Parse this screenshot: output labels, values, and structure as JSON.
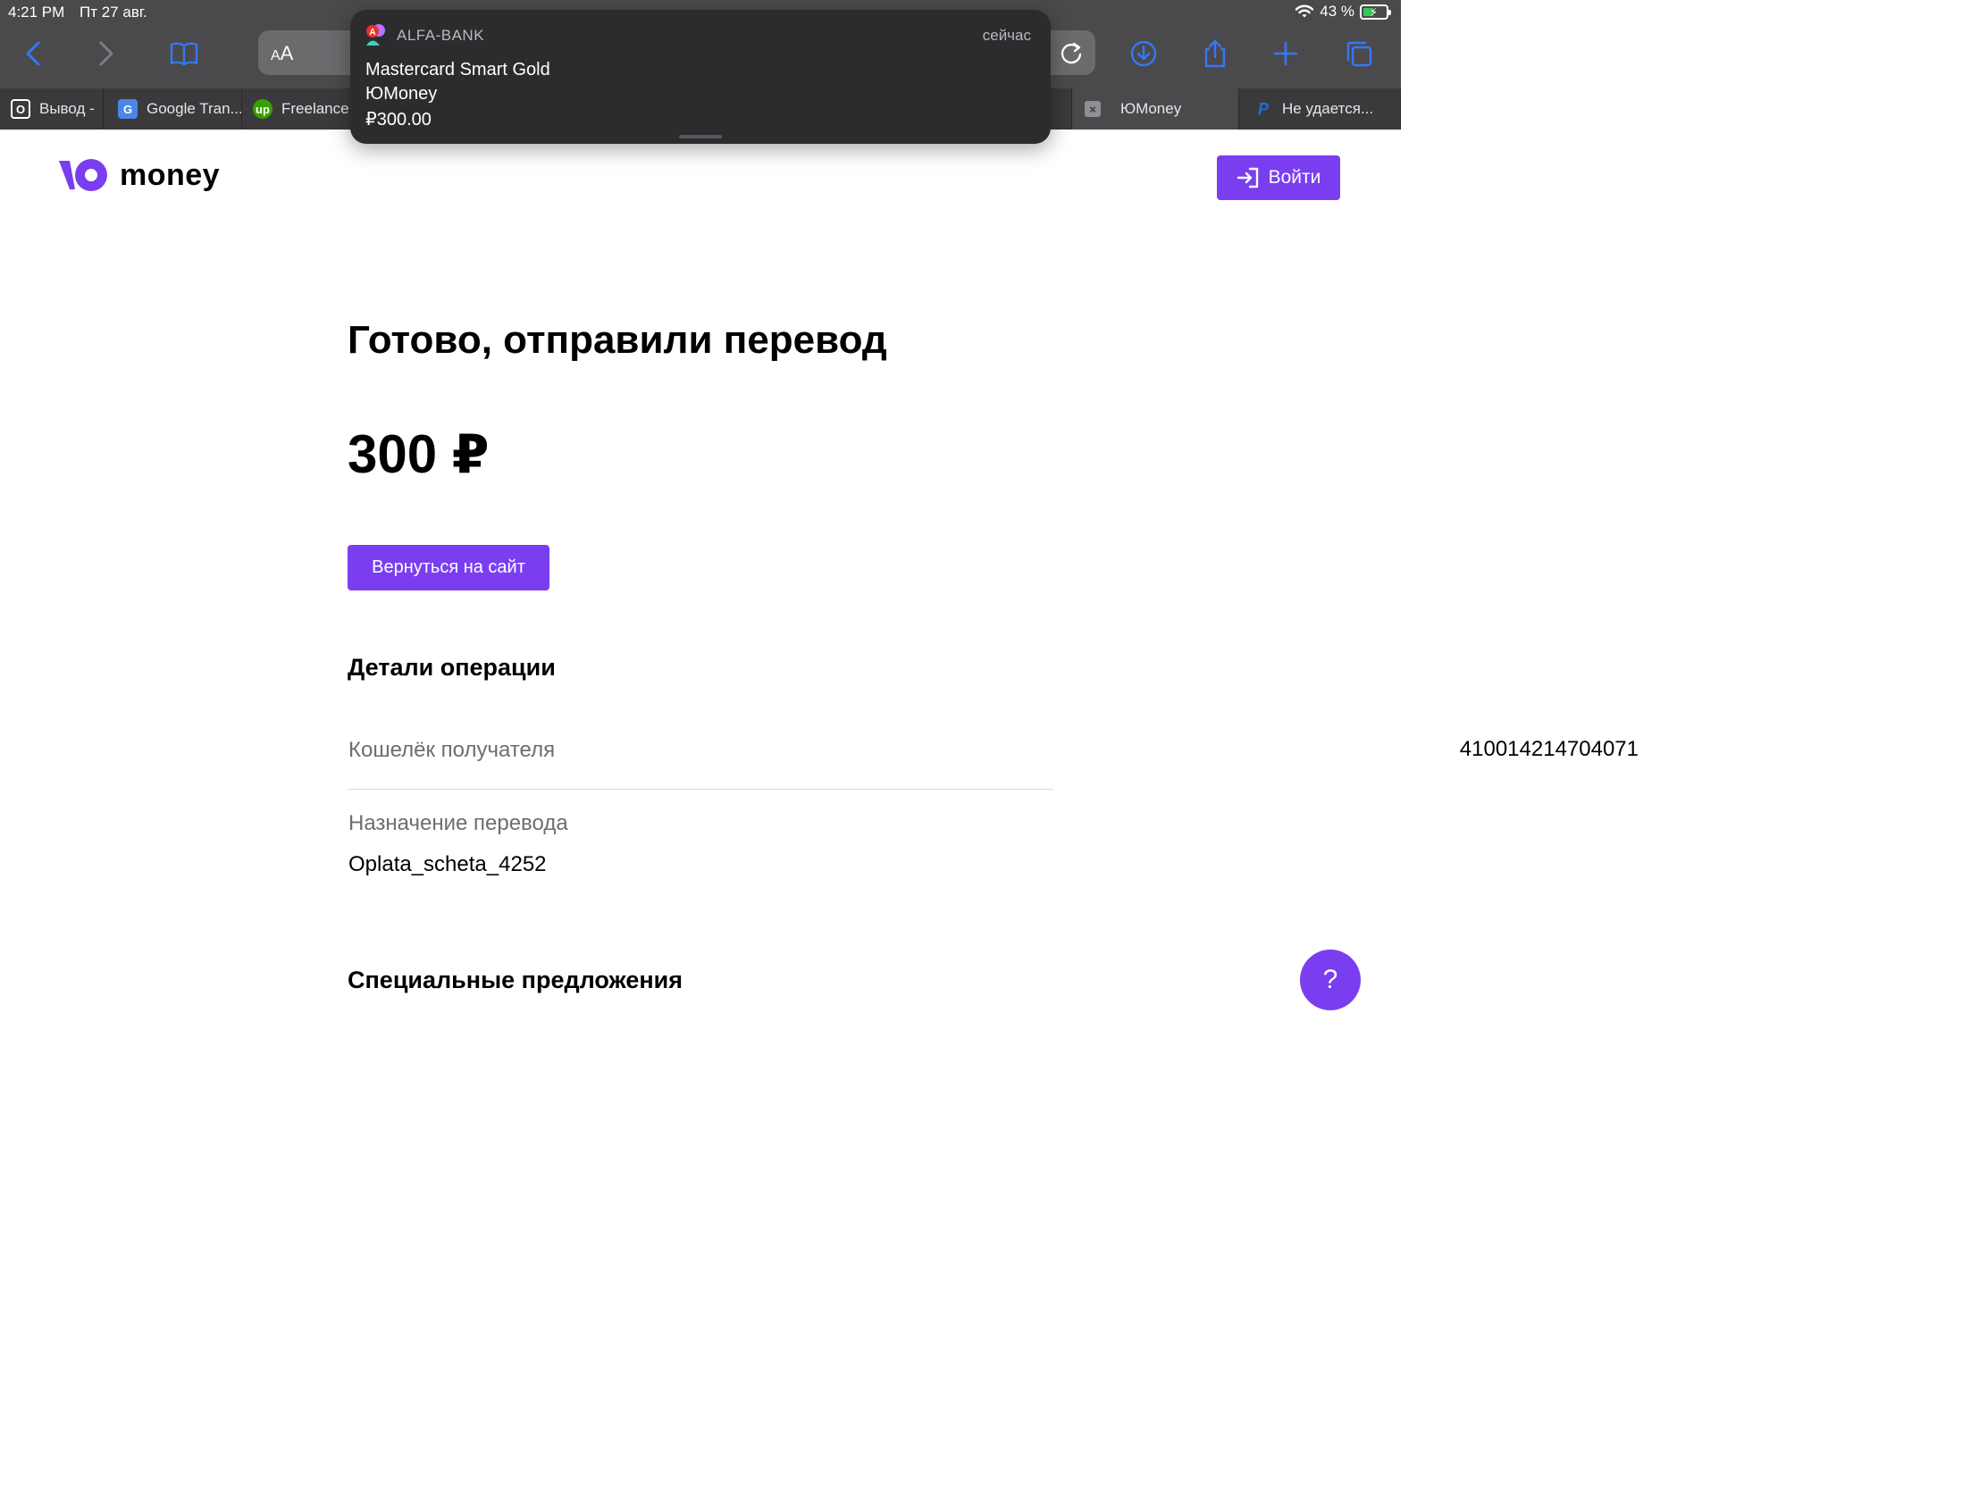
{
  "status_bar": {
    "time": "4:21 PM",
    "date": "Пт 27 авг.",
    "battery": "43 %"
  },
  "browser": {
    "text_size_label": "AA",
    "tabs": [
      {
        "label": "Вывод -",
        "favicon": "O"
      },
      {
        "label": "Google Tran...",
        "favicon": "G"
      },
      {
        "label": "Freelance",
        "favicon": "up"
      },
      {
        "label": "",
        "favicon": ""
      },
      {
        "label": "ЮMoney",
        "favicon": "×"
      },
      {
        "label": "Не удается...",
        "favicon": "P"
      }
    ]
  },
  "notification": {
    "app": "ALFA-BANK",
    "time": "сейчас",
    "line1": "Mastercard Smart Gold",
    "line2": "ЮMoney",
    "line3": "₽300.00"
  },
  "header": {
    "logo_text": "money",
    "login_label": "Войти"
  },
  "main": {
    "title": "Готово, отправили перевод",
    "amount": "300 ₽",
    "back_button": "Вернуться на сайт",
    "details_heading": "Детали операции",
    "wallet_label": "Кошелёк получателя",
    "wallet_value": "410014214704071",
    "purpose_label": "Назначение перевода",
    "purpose_value": "Oplata_scheta_4252",
    "offers_heading": "Специальные предложения"
  },
  "help": {
    "label": "?"
  },
  "colors": {
    "accent": "#7a3ef0",
    "chrome": "#4a4a4c",
    "link_blue": "#3478f6"
  }
}
